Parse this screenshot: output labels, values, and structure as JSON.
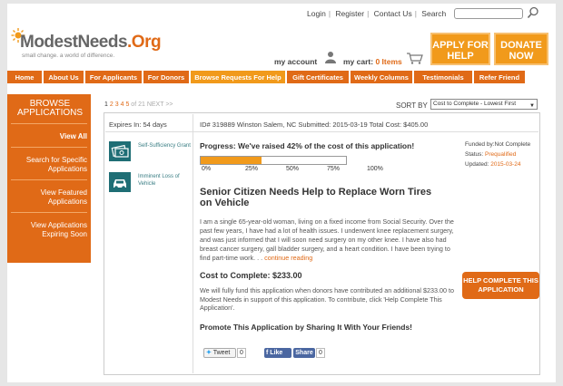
{
  "header": {
    "links": [
      "Login",
      "Register",
      "Contact Us",
      "Search"
    ],
    "logo_name": "ModestNeeds",
    "logo_tld": ".Org",
    "tagline": "small change. a world of difference.",
    "my_account": "my account",
    "my_cart": "my cart:",
    "cart_items": "0 Items",
    "apply_label": "APPLY FOR HELP",
    "donate_label": "DONATE NOW"
  },
  "nav": {
    "items": [
      "Home",
      "About Us",
      "For Applicants",
      "For Donors",
      "Browse Requests For Help",
      "Gift Certificates",
      "Weekly Columns",
      "Testimonials",
      "Refer Friend"
    ],
    "active_index": 4
  },
  "sidebar": {
    "title": "BROWSE APPLICATIONS",
    "items": [
      "View All",
      "Search for Specific Applications",
      "View Featured Applications",
      "View Applications Expiring Soon"
    ]
  },
  "pager": {
    "current": "1",
    "pages": [
      "2",
      "3",
      "4",
      "5"
    ],
    "of": "of 21",
    "next": "NEXT >>"
  },
  "sort": {
    "label": "SORT BY",
    "selected": "Cost to Complete - Lowest First"
  },
  "application": {
    "expires": "Expires In: 54 days",
    "id_line": "ID# 319889 Winston Salem, NC Submitted: 2015-03-19 Total Cost: $405.00",
    "categories": [
      "Self-Sufficiency Grant",
      "Imminent Loss of Vehicle"
    ],
    "progress_title": "Progress: We've raised 42% of the cost of this application!",
    "progress_fraction": 0.42,
    "progress_ticks": [
      "0%",
      "25%",
      "50%",
      "75%",
      "100%"
    ],
    "funded_by": "Funded by:Not Complete",
    "status_label": "Status:",
    "status_value": "Prequalified",
    "updated_label": "Updated:",
    "updated_value": "2015-03-24",
    "headline": "Senior Citizen Needs Help to Replace Worn Tires on Vehicle",
    "description": "I am a single 65-year-old woman, living on a fixed income from Social Security. Over the past few years, I have had a lot of health issues. I underwent knee replacement surgery, and was just informed that I will soon need surgery on my other knee. I have also had breast cancer surgery, gall bladder surgery, and a heart condition. I have been trying to find part-time work. . .",
    "continue": "continue reading",
    "cost_to_complete": "Cost to Complete: $233.00",
    "fund_text": "We will fully fund this application when donors have contributed an additional $233.00 to Modest Needs in support of this application. To contribute, click 'Help Complete This Application'.",
    "help_button": "HELP COMPLETE THIS APPLICATION",
    "promote": "Promote This Application by Sharing It With Your Friends!",
    "tweet_label": "Tweet",
    "tweet_count": "0",
    "like_label": "Like",
    "share_label": "Share",
    "share_count": "0"
  }
}
